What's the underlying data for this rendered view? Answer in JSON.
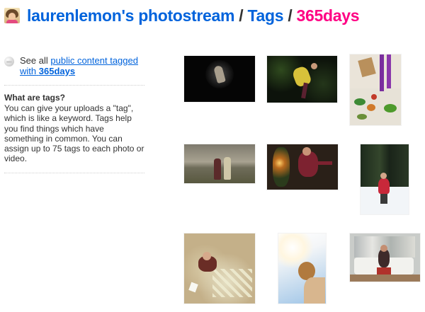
{
  "header": {
    "user_photostream": "laurenlemon's photostream",
    "sep1": " / ",
    "tags_link": "Tags",
    "sep2": " / ",
    "current_tag": "365days"
  },
  "sidebar": {
    "see_all_prefix": "See all",
    "see_all_link": "public content tagged with",
    "see_all_tag": "365days",
    "what_title": "What are tags?",
    "what_body": "You can give your uploads a \"tag\", which is like a keyword. Tags help you find things which have something in common. You can assign up to 75 tags to each photo or video."
  },
  "colors": {
    "link": "#0063dc",
    "tag": "#ff0084",
    "text": "#333333"
  },
  "icons": {
    "buddy": "buddy-icon",
    "globe": "globe-icon"
  }
}
